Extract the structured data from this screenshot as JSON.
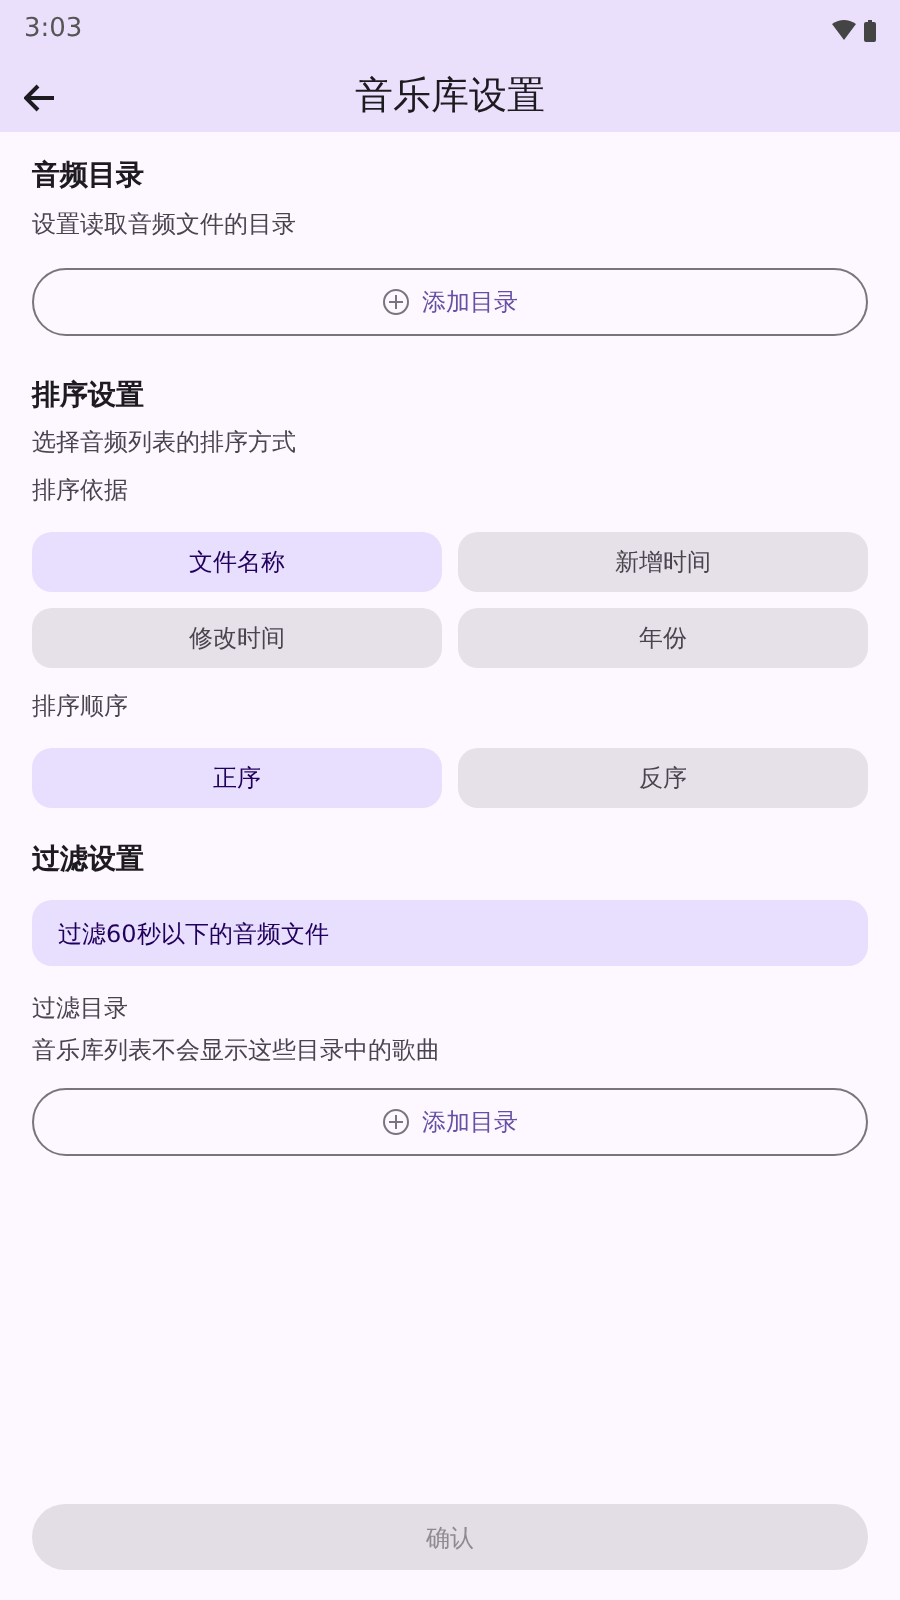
{
  "status_bar": {
    "time": "3:03"
  },
  "app_bar": {
    "title": "音乐库设置"
  },
  "audio_dirs": {
    "title": "音频目录",
    "subtitle": "设置读取音频文件的目录",
    "button": "添加目录"
  },
  "sorting": {
    "title": "排序设置",
    "subtitle": "选择音频列表的排序方式",
    "by_label": "排序依据",
    "by_options": [
      {
        "label": "文件名称",
        "selected": true
      },
      {
        "label": "新增时间",
        "selected": false
      },
      {
        "label": "修改时间",
        "selected": false
      },
      {
        "label": "年份",
        "selected": false
      }
    ],
    "order_label": "排序顺序",
    "order_options": [
      {
        "label": "正序",
        "selected": true
      },
      {
        "label": "反序",
        "selected": false
      }
    ]
  },
  "filter": {
    "title": "过滤设置",
    "toggle": {
      "label": "过滤60秒以下的音频文件",
      "selected": true
    },
    "dirs_label": "过滤目录",
    "dirs_subtitle": "音乐库列表不会显示这些目录中的歌曲",
    "button": "添加目录"
  },
  "confirm": {
    "label": "确认",
    "disabled": true
  }
}
